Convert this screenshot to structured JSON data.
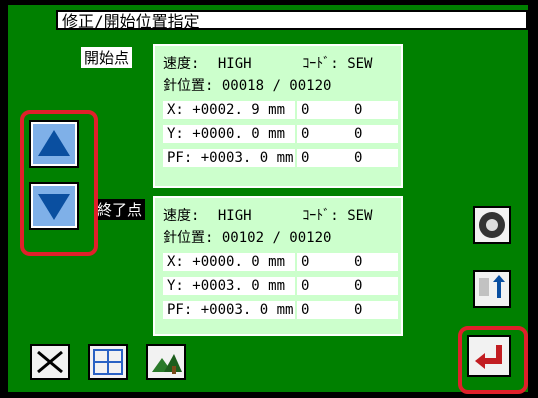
{
  "title": "修正/開始位置指定",
  "start": {
    "label": "開始点",
    "speed_label": "速度:",
    "speed": "HIGH",
    "code_label": "ｺｰﾄﾞ:",
    "code": "SEW",
    "needle_label": "針位置:",
    "needle": "00018 / 00120",
    "x_label": "X:",
    "x": "+0002. 9 mm",
    "x_a": "0",
    "x_b": "0",
    "y_label": "Y:",
    "y": "+0000. 0 mm",
    "y_a": "0",
    "y_b": "0",
    "pf_label": "PF:",
    "pf": "+0003. 0 mm",
    "pf_a": "0",
    "pf_b": "0"
  },
  "end": {
    "label": "終了点",
    "speed_label": "速度:",
    "speed": "HIGH",
    "code_label": "ｺｰﾄﾞ:",
    "code": "SEW",
    "needle_label": "針位置:",
    "needle": "00102 / 00120",
    "x_label": "X:",
    "x": "+0000. 0 mm",
    "x_a": "0",
    "x_b": "0",
    "y_label": "Y:",
    "y": "+0003. 0 mm",
    "y_a": "0",
    "y_b": "0",
    "pf_label": "PF:",
    "pf": "+0003. 0 mm",
    "pf_a": "0",
    "pf_b": "0"
  },
  "icons": {
    "up": "arrow-up-icon",
    "down": "arrow-down-icon",
    "cancel": "close-icon",
    "focus": "focus-icon",
    "scene": "landscape-icon",
    "gear": "gear-icon",
    "origin": "origin-icon",
    "enter": "enter-icon"
  }
}
